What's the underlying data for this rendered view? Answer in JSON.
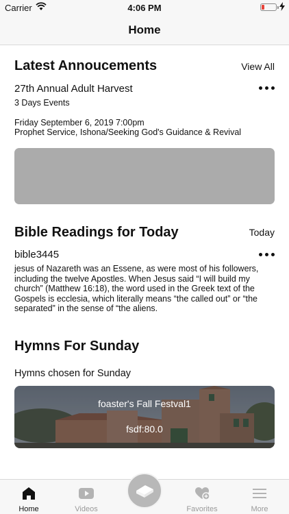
{
  "status_bar": {
    "carrier": "Carrier",
    "time": "4:06 PM"
  },
  "nav": {
    "title": "Home"
  },
  "announcements": {
    "title": "Latest Annoucements",
    "link": "View All",
    "event_title": "27th Annual Adult Harvest",
    "event_subtitle": "3 Days Events",
    "event_date": "Friday September 6, 2019 7:00pm",
    "event_desc": "Prophet Service, Ishona/Seeking God's Guidance & Revival"
  },
  "bible": {
    "title": "Bible Readings for Today",
    "link": "Today",
    "reading_title": "bible3445",
    "reading_text": "jesus of Nazareth was an Essene, as were most of his followers, including the twelve Apostles. When Jesus said “I will build my church” (Matthew 16:18), the word used in the Greek text of the Gospels is ecclesia, which literally means “the called out” or “the separated” in the sense of “the aliens."
  },
  "hymns": {
    "title": "Hymns For Sunday",
    "subtitle": "Hymns chosen for Sunday",
    "card_title": "foaster's Fall Festval1",
    "card_subtitle": "fsdf:80.0"
  },
  "tabs": [
    {
      "label": "Home",
      "icon": "home-icon",
      "active": true
    },
    {
      "label": "Videos",
      "icon": "video-icon",
      "active": false
    },
    {
      "label": "Favorites",
      "icon": "heart-plus-icon",
      "active": false
    },
    {
      "label": "More",
      "icon": "menu-icon",
      "active": false
    }
  ],
  "center_button_icon": "bible-icon"
}
